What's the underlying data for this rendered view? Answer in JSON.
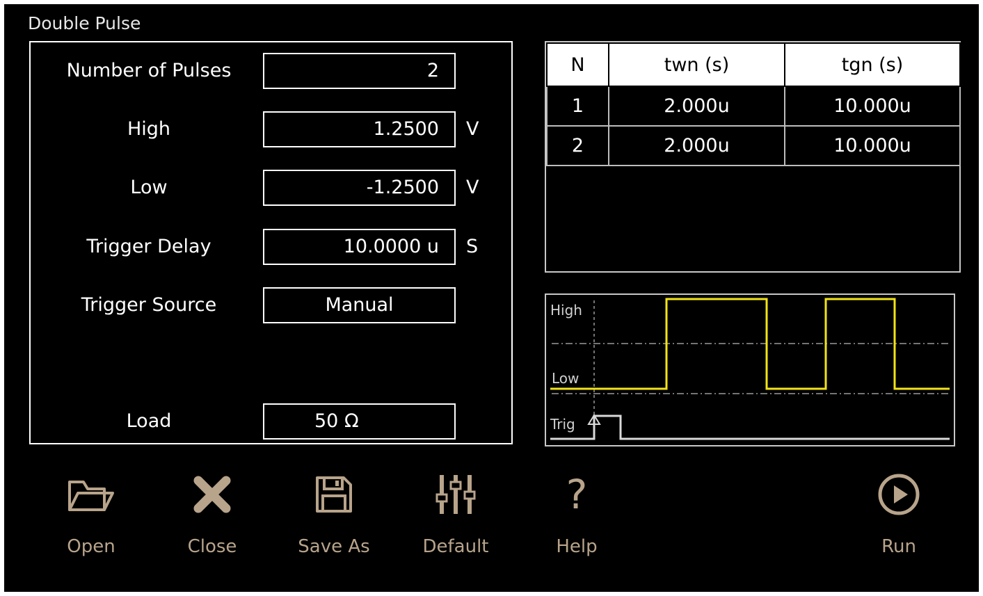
{
  "window": {
    "title": "Double Pulse"
  },
  "params": [
    {
      "label": "Number of Pulses",
      "value": "2",
      "unit": ""
    },
    {
      "label": "High",
      "value": "1.2500",
      "unit": "V"
    },
    {
      "label": "Low",
      "value": "-1.2500",
      "unit": "V"
    },
    {
      "label": "Trigger Delay",
      "value": "10.0000 u",
      "unit": "S"
    },
    {
      "label": "Trigger Source",
      "value": "Manual",
      "unit": ""
    },
    {
      "label": "Load",
      "value": "50 Ω",
      "unit": ""
    }
  ],
  "pulse_table": {
    "headers": [
      "N",
      "twn (s)",
      "tgn (s)"
    ],
    "rows": [
      [
        "1",
        "2.000u",
        "10.000u"
      ],
      [
        "2",
        "2.000u",
        "10.000u"
      ]
    ]
  },
  "waveform": {
    "labels": {
      "high": "High",
      "low": "Low",
      "trig": "Trig"
    },
    "pulse_color": "#f2e318",
    "trace_color": "#d9d9d9"
  },
  "toolbar": {
    "open": "Open",
    "close": "Close",
    "save_as": "Save As",
    "default": "Default",
    "help": "Help",
    "run": "Run",
    "icon_color": "#b8a48b"
  }
}
